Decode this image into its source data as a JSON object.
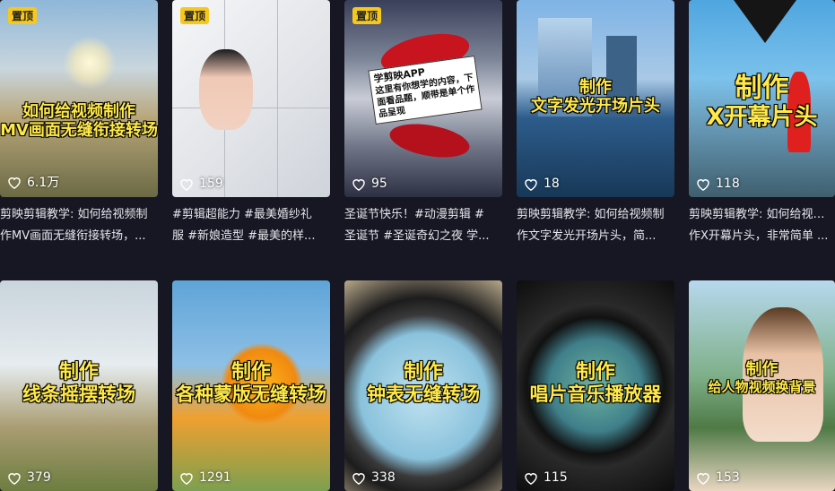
{
  "grid": {
    "pinned_label": "置顶",
    "row1": [
      {
        "title_l1": "如何给视频制作",
        "title_l2": "MV画面无缝衔接转场",
        "likes": "6.1万",
        "pinned": true,
        "desc_l1": "剪映剪辑教学: 如何给视频制",
        "desc_l2": "作MV画面无缝衔接转场，..."
      },
      {
        "title_l1": "",
        "title_l2": "",
        "likes": "159",
        "pinned": true,
        "desc_l1": "#剪辑超能力 #最美婚纱礼",
        "desc_l2": "服 #新娘造型 #最美的样..."
      },
      {
        "title_l1": "",
        "title_l2": "",
        "likes": "95",
        "pinned": true,
        "stamp_title": "学剪映APP",
        "stamp_body": "这里有你想学的内容，下面看品题，顺带是单个作品呈现",
        "desc_l1": "圣诞节快乐！#动漫剪辑 #",
        "desc_l2": "圣诞节 #圣诞奇幻之夜 学..."
      },
      {
        "title_l1": "制作",
        "title_l2": "文字发光开场片头",
        "likes": "18",
        "pinned": false,
        "desc_l1": "剪映剪辑教学: 如何给视频制",
        "desc_l2": "作文字发光开场片头，简..."
      },
      {
        "title_l1": "制作",
        "title_l2": "X开幕片头",
        "likes": "118",
        "pinned": false,
        "desc_l1": "剪映剪辑教学: 如何给视频制",
        "desc_l2": "作X开幕片头，非常简单 ..."
      }
    ],
    "row2": [
      {
        "title_l1": "制作",
        "title_l2": "线条摇摆转场",
        "likes": "379"
      },
      {
        "title_l1": "制作",
        "title_l2": "各种蒙版无缝转场",
        "likes": "1291"
      },
      {
        "title_l1": "制作",
        "title_l2": "钟表无缝转场",
        "likes": "338"
      },
      {
        "title_l1": "制作",
        "title_l2": "唱片音乐播放器",
        "likes": "115"
      },
      {
        "title_l1": "制作",
        "title_l2": "给人物视频换背景",
        "likes": "153"
      }
    ]
  }
}
